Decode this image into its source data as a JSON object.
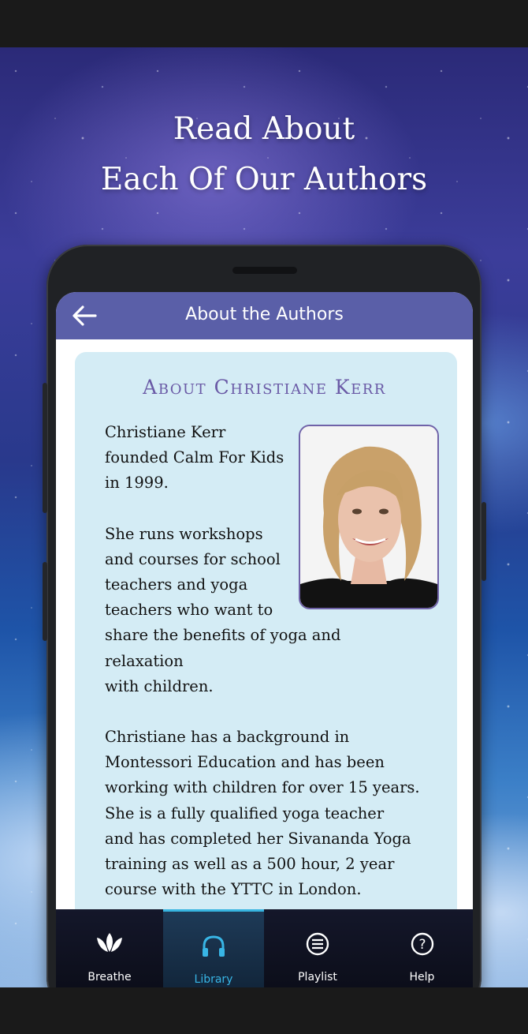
{
  "promo": {
    "line1": "Read About",
    "line2": "Each Of Our Authors"
  },
  "appbar": {
    "title": "About the Authors",
    "back_icon": "arrow-left-icon"
  },
  "author": {
    "heading": "About Christiane Kerr",
    "photo_alt": "Christiane Kerr portrait",
    "p1": [
      "Christiane Kerr",
      "founded Calm For Kids",
      "in 1999."
    ],
    "p2": [
      "She runs workshops",
      "and courses for school",
      "teachers and yoga",
      "teachers who want to",
      "share the benefits of yoga and relaxation",
      "with children."
    ],
    "p3": [
      "Christiane has a background in",
      "Montessori Education and has been",
      "working with children for over 15 years.",
      "She is a fully qualified yoga teacher",
      "and has completed her Sivananda Yoga",
      "training as well as a 500 hour, 2 year",
      "course with the YTTC in London."
    ]
  },
  "tabs": [
    {
      "label": "Breathe",
      "icon": "lotus-icon",
      "active": false
    },
    {
      "label": "Library",
      "icon": "headphones-icon",
      "active": true
    },
    {
      "label": "Playlist",
      "icon": "list-icon",
      "active": false
    },
    {
      "label": "Help",
      "icon": "help-icon",
      "active": false
    }
  ],
  "colors": {
    "appbar": "#5a5fa8",
    "card": "#d4ecf5",
    "heading": "#6a5aa6",
    "active_tab": "#38b6e6"
  }
}
